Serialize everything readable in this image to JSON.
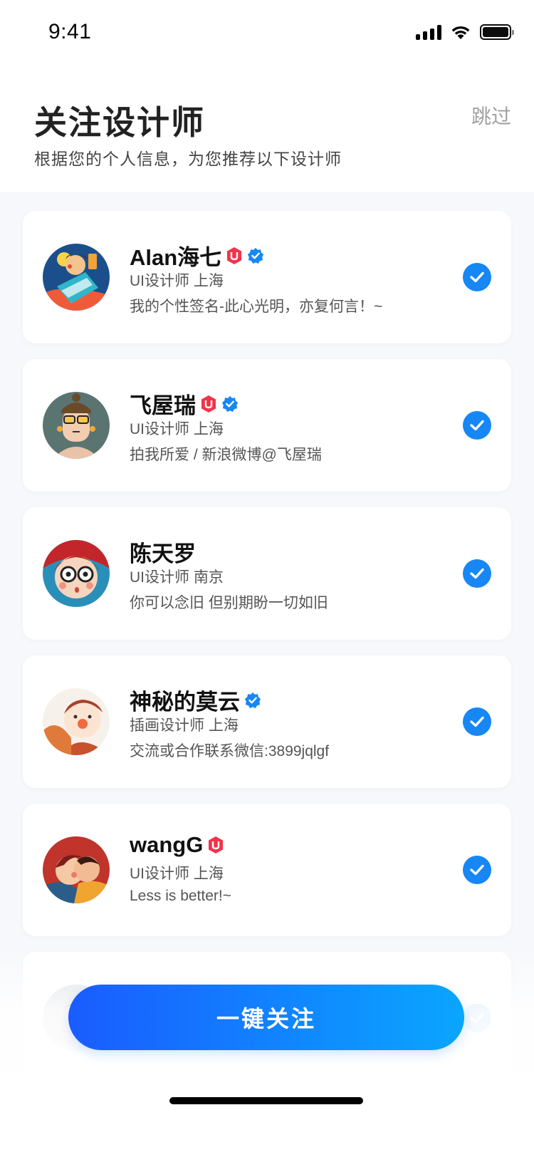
{
  "status_bar": {
    "time": "9:41"
  },
  "header": {
    "title": "关注设计师",
    "subtitle": "根据您的个人信息，为您推荐以下设计师",
    "skip_label": "跳过"
  },
  "designers": [
    {
      "name": "Alan海七",
      "role": "UI设计师 上海",
      "signature": "我的个性签名-此心光明，亦复何言！~",
      "badges": [
        "ui-badge-icon",
        "verified-icon"
      ],
      "selected": true
    },
    {
      "name": "飞屋瑞",
      "role": "UI设计师 上海",
      "signature": "拍我所爱 / 新浪微博@飞屋瑞",
      "badges": [
        "ui-badge-icon",
        "verified-icon"
      ],
      "selected": true
    },
    {
      "name": "陈天罗",
      "role": "UI设计师 南京",
      "signature": "你可以念旧 但别期盼一切如旧",
      "badges": [],
      "selected": true
    },
    {
      "name": "神秘的莫云",
      "role": "插画设计师 上海",
      "signature": "交流或合作联系微信:3899jqlgf",
      "badges": [
        "verified-icon"
      ],
      "selected": true
    },
    {
      "name": "wangG",
      "role": "UI设计师 上海",
      "signature": "Less is better!~",
      "badges": [
        "ui-badge-icon"
      ],
      "selected": true
    }
  ],
  "footer": {
    "follow_all_label": "一键关注"
  },
  "colors": {
    "accent": "#1687f5",
    "badge_red": "#f0344a",
    "button_start": "#1a5cff",
    "button_end": "#0aa6ff"
  }
}
